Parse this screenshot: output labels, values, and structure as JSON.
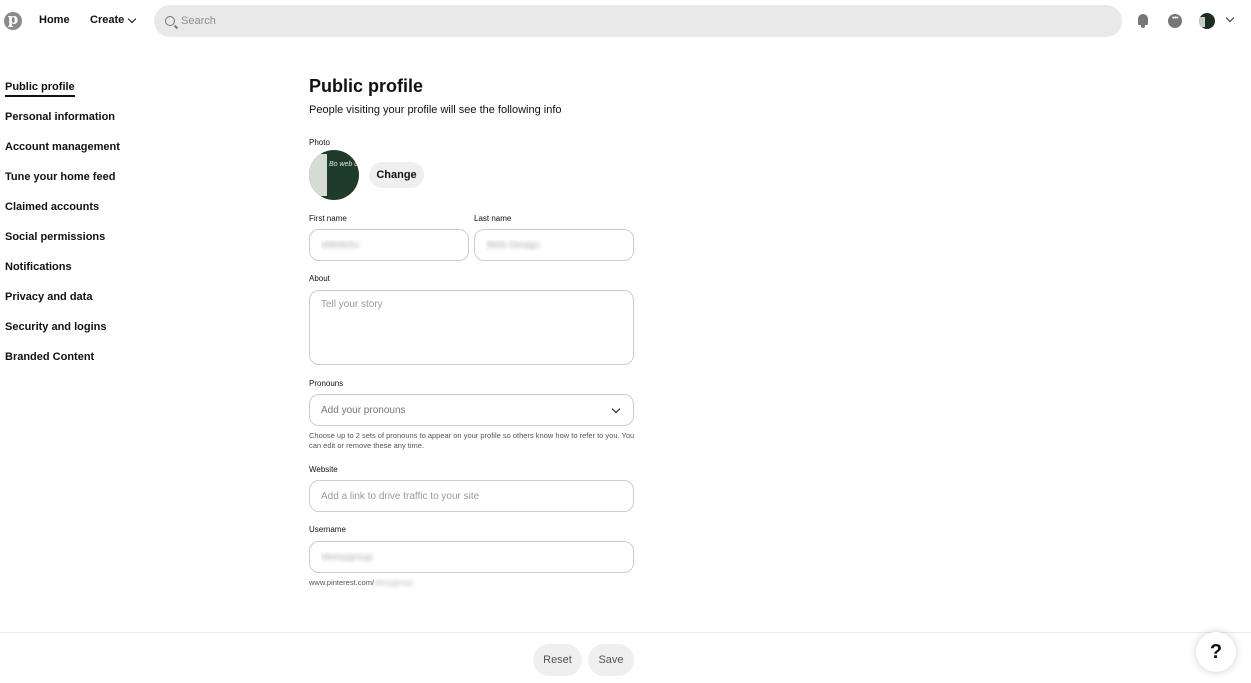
{
  "header": {
    "logo": "pinterest-logo-icon",
    "home_label": "Home",
    "create_label": "Create",
    "search_placeholder": "Search"
  },
  "sidebar": {
    "items": [
      {
        "label": "Public profile",
        "active": true
      },
      {
        "label": "Personal information"
      },
      {
        "label": "Account management"
      },
      {
        "label": "Tune your home feed"
      },
      {
        "label": "Claimed accounts"
      },
      {
        "label": "Social permissions"
      },
      {
        "label": "Notifications"
      },
      {
        "label": "Privacy and data"
      },
      {
        "label": "Security and logins"
      },
      {
        "label": "Branded Content"
      }
    ]
  },
  "main": {
    "title": "Public profile",
    "subtitle": "People visiting your profile will see the following info",
    "photo_label": "Photo",
    "photo_text": "Bo web de in Lago",
    "change_label": "Change",
    "first_name_label": "First name",
    "first_name_value": "eWebSo",
    "last_name_label": "Last name",
    "last_name_value": "Web Design",
    "about_label": "About",
    "about_placeholder": "Tell your story",
    "pronouns_label": "Pronouns",
    "pronouns_placeholder": "Add your pronouns",
    "pronouns_help": "Choose up to 2 sets of pronouns to appear on your profile so others know how to refer to you. You can edit or remove these any time.",
    "website_label": "Website",
    "website_placeholder": "Add a link to drive traffic to your site",
    "username_label": "Username",
    "username_value": "ekesygroup",
    "profile_url_prefix": "www.pinterest.com/",
    "profile_url_user": "ekesygroup"
  },
  "footer": {
    "reset_label": "Reset",
    "save_label": "Save",
    "help_label": "?"
  }
}
